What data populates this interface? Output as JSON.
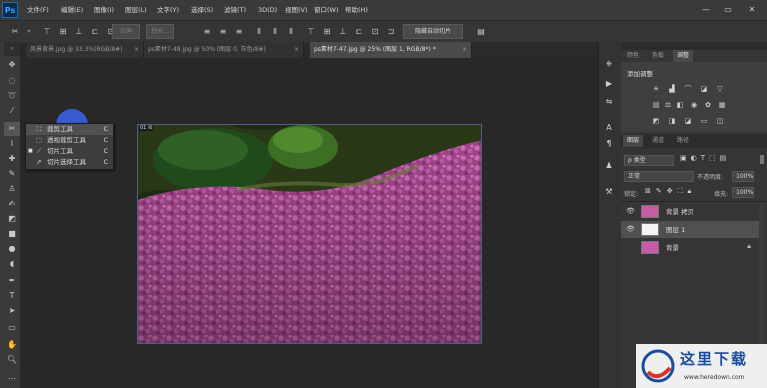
{
  "app": {
    "logo": "Ps"
  },
  "menubar": {
    "items": [
      "文件(F)",
      "编辑(E)",
      "图像(I)",
      "图层(L)",
      "文字(Y)",
      "选择(S)",
      "滤镜(T)",
      "3D(D)",
      "视图(V)",
      "窗口(W)",
      "帮助(H)"
    ],
    "window_controls": {
      "minimize": "—",
      "restore": "▭",
      "close": "✕"
    }
  },
  "options_bar": {
    "buttons": [
      "拉伸",
      "划分...",
      "隐藏自动切片"
    ]
  },
  "tabs": [
    {
      "label": "风景背景.jpg @ 33.3%(RGB/8#)",
      "close": "×",
      "active": false
    },
    {
      "label": "ps素材7-48.jpg @ 50% (图层 0, 灰色/8#)",
      "close": "×",
      "active": false
    },
    {
      "label": "ps素材7-47.jpg @ 25% (图层 1, RGB/8*) *",
      "close": "×",
      "active": true
    }
  ],
  "tool_flyout": {
    "items": [
      {
        "icon": "crop-icon",
        "label": "裁剪工具",
        "key": "C",
        "selected": true
      },
      {
        "icon": "perspective-crop-icon",
        "label": "透视裁剪工具",
        "key": "C",
        "selected": false
      },
      {
        "icon": "slice-icon",
        "label": "切片工具",
        "key": "C",
        "selected": false
      },
      {
        "icon": "slice-select-icon",
        "label": "切片选择工具",
        "key": "C",
        "selected": false
      }
    ]
  },
  "canvas": {
    "artboard_tag": "01 ☒"
  },
  "right_panel": {
    "top_tabs": [
      "颜色",
      "色板",
      "调整"
    ],
    "adjustments_title": "添加调整",
    "layers_tabs": [
      "图层",
      "通道",
      "路径"
    ],
    "filter_label": "ρ 类型",
    "blend_mode": "正常",
    "opacity_label": "不透明度:",
    "opacity_value": "100%",
    "lock_label": "锁定:",
    "fill_label": "填充:",
    "fill_value": "100%",
    "layers": [
      {
        "name": "背景 拷贝",
        "visible": true,
        "selected": false,
        "locked": false
      },
      {
        "name": "图层 1",
        "visible": true,
        "selected": true,
        "locked": false
      },
      {
        "name": "背景",
        "visible": false,
        "selected": false,
        "locked": true
      }
    ]
  },
  "watermark": {
    "title": "这里下载",
    "url": "www.heredown.com"
  },
  "colors": {
    "accent": "#31a8ff",
    "cursor_highlight": "#3a5bd0",
    "flower_pink": "#d361b8"
  }
}
